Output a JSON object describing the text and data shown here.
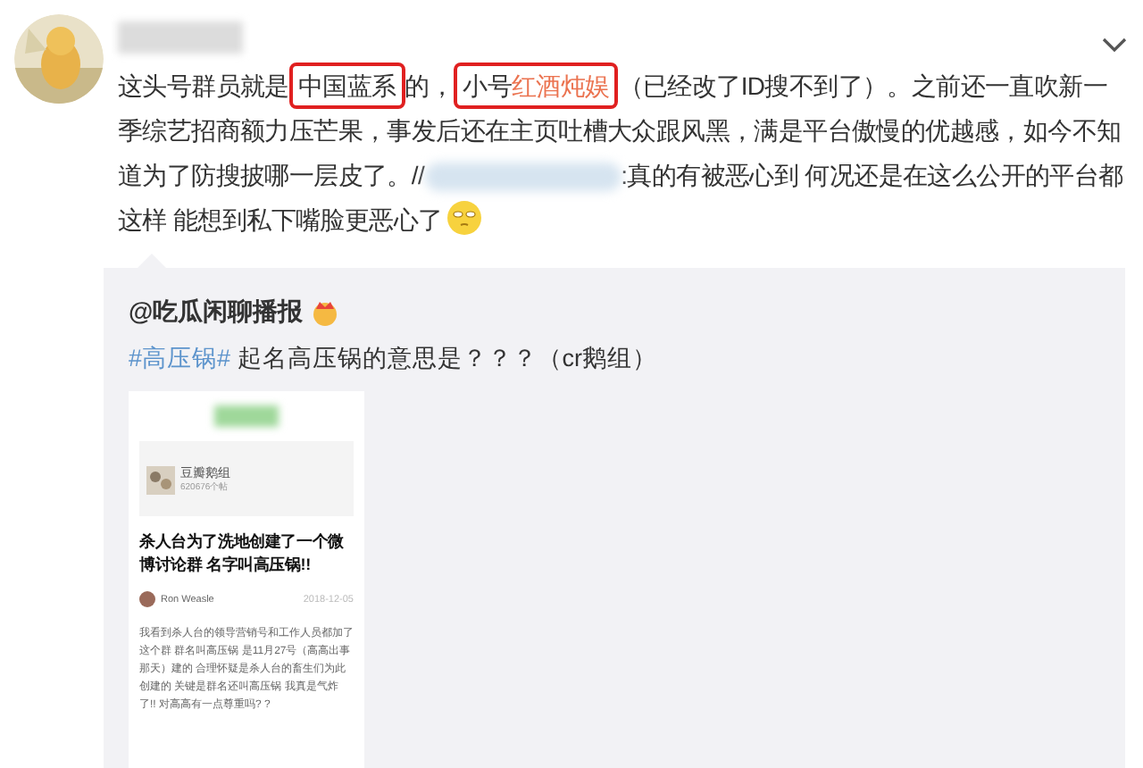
{
  "post": {
    "segments": [
      {
        "kind": "text",
        "text": "这头号群员就是"
      },
      {
        "kind": "box",
        "segments": [
          {
            "kind": "text",
            "text": "中国蓝系"
          }
        ]
      },
      {
        "kind": "text",
        "text": "的，"
      },
      {
        "kind": "box",
        "segments": [
          {
            "kind": "text",
            "text": "小号"
          },
          {
            "kind": "link",
            "text": "红酒炖娱"
          }
        ]
      },
      {
        "kind": "text",
        "text": "（已经改了ID搜不到了）。之前还一直吹新一季综艺招商额力压芒果，事发后还在主页吐槽大众跟风黑，满是平台傲慢的优越感，如今不知道为了防搜披哪一层皮了。//"
      },
      {
        "kind": "blur"
      },
      {
        "kind": "text",
        "text": ":真的有被恶心到 何况还是在这么公开的平台都这样 能想到私下嘴脸更恶心了"
      },
      {
        "kind": "emoji"
      }
    ]
  },
  "repost": {
    "author": "@吃瓜闲聊播报",
    "topic": "#高压锅#",
    "text": "起名高压锅的意思是？？？（cr鹅组）",
    "screenshot": {
      "group_name": "豆瓣鹅组",
      "group_count": "620676个帖",
      "title": "杀人台为了洗地创建了一个微博讨论群 名字叫高压锅!!",
      "user": "Ron Weasle",
      "date": "2018-12-05",
      "body": "我看到杀人台的领导营销号和工作人员都加了这个群 群名叫高压锅 是11月27号（高高出事那天）建的 合理怀疑是杀人台的畜生们为此创建的 关键是群名还叫高压锅 我真是气炸了!! 对高高有一点尊重吗? ?"
    }
  }
}
